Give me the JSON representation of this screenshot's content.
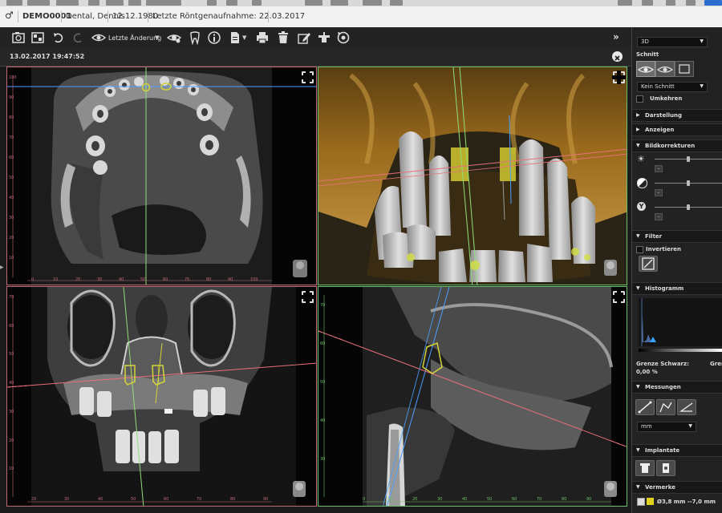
{
  "patient_bar": {
    "id": "DEMO0001",
    "name": "Dental, Dennis",
    "dob": "12.12.1980",
    "last_xray": "Letzte Röntgenaufnahme: 22.03.2017"
  },
  "toolbar": {
    "last_change_label": "Letzte Änderung"
  },
  "session": {
    "datetime": "13.02.2017 19:47:52"
  },
  "views": {
    "axial_ruler_top": [
      "100",
      "90",
      "80",
      "70",
      "60",
      "50",
      "40",
      "30",
      "20",
      "10"
    ],
    "axial_ruler_bottom": [
      "0",
      "10",
      "20",
      "30",
      "40",
      "50",
      "60",
      "70",
      "80",
      "90",
      "100"
    ],
    "coronal_ruler_left": [
      "70",
      "60",
      "50",
      "40",
      "30",
      "20",
      "10"
    ],
    "coronal_ruler_bottom": [
      "20",
      "30",
      "40",
      "50",
      "60",
      "70",
      "80",
      "90"
    ],
    "sagittal_ruler_left": [
      "70",
      "60",
      "50",
      "40",
      "30"
    ],
    "sagittal_ruler_bottom": [
      "0",
      "10",
      "20",
      "30",
      "40",
      "50",
      "60",
      "70",
      "80",
      "90"
    ]
  },
  "right_panel": {
    "render_mode": "3D",
    "schnitt_label": "Schnitt",
    "schnitt_value": "Kein Schnitt",
    "umkehren_label": "Umkehren",
    "sections": {
      "darstellung": "Darstellung",
      "anzeigen": "Anzeigen",
      "bildkorrekturen": "Bildkorrekturen",
      "filter": "Filter",
      "histogramm": "Histogramm",
      "messungen": "Messungen",
      "implantate": "Implantate",
      "vermerke": "Vermerke"
    },
    "invertieren_label": "Invertieren",
    "grenze_schwarz_label": "Grenze Schwarz:",
    "grenze_cut_label": "Gren",
    "grenze_schwarz_value": "0,00 %",
    "unit_value": "mm",
    "vermerk_text": "Ø3,8 mm --7,0 mm"
  },
  "colors": {
    "axial_frame": "#c06a78",
    "green_frame": "#6bbf6b",
    "red_line": "#e8707a",
    "green_line": "#8fe07a",
    "blue_line": "#4aa0ff",
    "implant": "#d4d43a"
  }
}
